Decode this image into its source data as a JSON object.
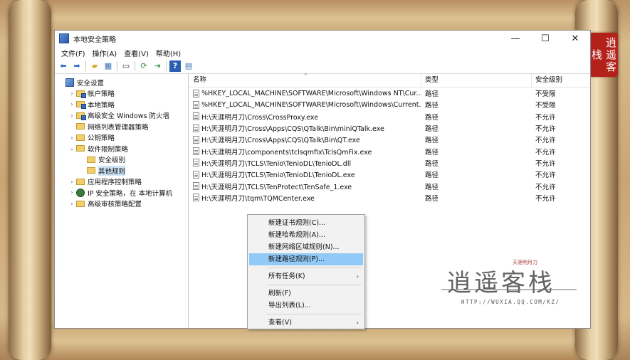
{
  "window": {
    "title": "本地安全策略",
    "controls": {
      "minimize": "—",
      "maximize": "☐",
      "close": "✕"
    }
  },
  "menubar": {
    "items": [
      "文件(F)",
      "操作(A)",
      "查看(V)",
      "帮助(H)"
    ]
  },
  "toolbar": {
    "icons": [
      "back-arrow-icon",
      "forward-arrow-icon",
      "up-folder-icon",
      "show-hide-tree-icon",
      "properties-icon",
      "refresh-icon",
      "export-list-icon",
      "help-icon",
      "view-icon"
    ]
  },
  "tree": {
    "items": [
      {
        "label": "安全设置",
        "icon": "root",
        "indent": 0,
        "expander": ""
      },
      {
        "label": "帐户策略",
        "icon": "folder-lock",
        "indent": 1,
        "expander": "›"
      },
      {
        "label": "本地策略",
        "icon": "folder-lock",
        "indent": 1,
        "expander": "›"
      },
      {
        "label": "高级安全 Windows 防火墙",
        "icon": "folder-lock",
        "indent": 1,
        "expander": "›"
      },
      {
        "label": "网络列表管理器策略",
        "icon": "folder",
        "indent": 1,
        "expander": ""
      },
      {
        "label": "公钥策略",
        "icon": "folder",
        "indent": 1,
        "expander": "›"
      },
      {
        "label": "软件限制策略",
        "icon": "folder",
        "indent": 1,
        "expander": "⌄"
      },
      {
        "label": "安全级别",
        "icon": "folder",
        "indent": 2,
        "expander": ""
      },
      {
        "label": "其他规则",
        "icon": "folder",
        "indent": 2,
        "expander": "",
        "selected": true
      },
      {
        "label": "应用程序控制策略",
        "icon": "folder",
        "indent": 1,
        "expander": "›"
      },
      {
        "label": "IP 安全策略，在 本地计算机",
        "icon": "ip",
        "indent": 1,
        "expander": "›"
      },
      {
        "label": "高级审核策略配置",
        "icon": "folder",
        "indent": 1,
        "expander": "›"
      }
    ]
  },
  "list": {
    "columns": [
      "名称",
      "类型",
      "安全级别"
    ],
    "sort_indicator": "^",
    "rows": [
      {
        "name": "%HKEY_LOCAL_MACHINE\\SOFTWARE\\Microsoft\\Windows NT\\Cur...",
        "type": "路径",
        "level": "不受限"
      },
      {
        "name": "%HKEY_LOCAL_MACHINE\\SOFTWARE\\Microsoft\\Windows\\Current...",
        "type": "路径",
        "level": "不受限"
      },
      {
        "name": "H:\\天涯明月刀\\Cross\\CrossProxy.exe",
        "type": "路径",
        "level": "不允许"
      },
      {
        "name": "H:\\天涯明月刀\\Cross\\Apps\\CQS\\QTalk\\Bin\\miniQTalk.exe",
        "type": "路径",
        "level": "不允许"
      },
      {
        "name": "H:\\天涯明月刀\\Cross\\Apps\\CQS\\QTalk\\Bin\\QT.exe",
        "type": "路径",
        "level": "不允许"
      },
      {
        "name": "H:\\天涯明月刀\\components\\tclsqmfix\\TclsQmFix.exe",
        "type": "路径",
        "level": "不允许"
      },
      {
        "name": "H:\\天涯明月刀\\TCLS\\Tenio\\TenioDL\\TenioDL.dll",
        "type": "路径",
        "level": "不允许"
      },
      {
        "name": "H:\\天涯明月刀\\TCLS\\Tenio\\TenioDL\\TenioDL.exe",
        "type": "路径",
        "level": "不允许"
      },
      {
        "name": "H:\\天涯明月刀\\TCLS\\TenProtect\\TenSafe_1.exe",
        "type": "路径",
        "level": "不允许"
      },
      {
        "name": "H:\\天涯明月刀\\tqm\\TQMCenter.exe",
        "type": "路径",
        "level": "不允许"
      }
    ]
  },
  "context_menu": {
    "items": [
      {
        "label": "新建证书规则(C)...",
        "type": "item"
      },
      {
        "label": "新建哈希规则(A)...",
        "type": "item"
      },
      {
        "label": "新建网络区域规则(N)...",
        "type": "item"
      },
      {
        "label": "新建路径规则(P)...",
        "type": "item",
        "highlight": true
      },
      {
        "type": "separator"
      },
      {
        "label": "所有任务(K)",
        "type": "item",
        "submenu": "›"
      },
      {
        "type": "separator"
      },
      {
        "label": "刷新(F)",
        "type": "item"
      },
      {
        "label": "导出列表(L)...",
        "type": "item"
      },
      {
        "type": "separator"
      },
      {
        "label": "查看(V)",
        "type": "item",
        "submenu": "›"
      }
    ]
  },
  "watermark": {
    "title": "逍遥客栈",
    "url": "HTTP://WUXIA.QQ.COM/KZ/",
    "seal": "逍遥客栈",
    "tiny": "天涯明月刀"
  },
  "colors": {
    "highlight": "#91c9f7",
    "selection": "#cce4f7",
    "parchment": "#d8bb8a",
    "seal": "#b3221a"
  }
}
